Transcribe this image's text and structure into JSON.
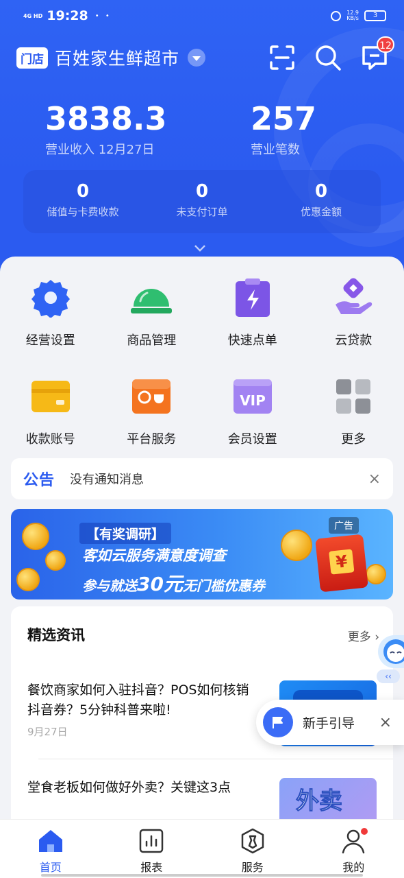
{
  "status_bar": {
    "network": "4G HD",
    "time": "19:28",
    "dots": "• •",
    "speed_value": "12.9",
    "speed_unit": "KB/s",
    "battery": "3"
  },
  "store": {
    "tag": "门店",
    "name": "百姓家生鲜超市",
    "message_badge": "12"
  },
  "kpis": {
    "revenue_value": "3838.3",
    "revenue_label": "营业收入 12月27日",
    "count_value": "257",
    "count_label": "营业笔数"
  },
  "sub_stats": [
    {
      "value": "0",
      "label": "储值与卡费收款"
    },
    {
      "value": "0",
      "label": "未支付订单"
    },
    {
      "value": "0",
      "label": "优惠金额"
    }
  ],
  "grid": [
    {
      "label": "经营设置",
      "icon": "gear-icon"
    },
    {
      "label": "商品管理",
      "icon": "service-bell-icon"
    },
    {
      "label": "快速点单",
      "icon": "lightning-clipboard-icon"
    },
    {
      "label": "云贷款",
      "icon": "loan-hand-icon"
    },
    {
      "label": "收款账号",
      "icon": "card-icon"
    },
    {
      "label": "平台服务",
      "icon": "platform-icon"
    },
    {
      "label": "会员设置",
      "icon": "vip-icon"
    },
    {
      "label": "更多",
      "icon": "more-grid-icon"
    }
  ],
  "notice": {
    "tag_a": "公",
    "tag_b": "告",
    "message": "没有通知消息",
    "close": "×"
  },
  "banner": {
    "line1": "【有奖调研】",
    "line2": "客如云服务满意度调查",
    "line3_a": "参与就送",
    "line3_b": "30元",
    "line3_c": "无门槛优惠券",
    "ad": "广告",
    "yen": "¥"
  },
  "news": {
    "heading": "精选资讯",
    "more": "更多 ›",
    "articles": [
      {
        "title": "餐饮商家如何入驻抖音？POS如何核销抖音券？5分钟科普来啦!",
        "date": "9月27日"
      },
      {
        "title": "堂食老板如何做好外卖？关键这3点",
        "date": "",
        "thumb_text": "外卖"
      }
    ]
  },
  "guide": {
    "label": "新手引导",
    "close": "×"
  },
  "mascot_tab": "‹‹",
  "tabs": [
    {
      "label": "首页",
      "icon": "home-icon",
      "active": true
    },
    {
      "label": "报表",
      "icon": "chart-icon"
    },
    {
      "label": "服务",
      "icon": "service-icon"
    },
    {
      "label": "我的",
      "icon": "profile-icon"
    }
  ],
  "colors": {
    "brand_blue": "#2b5bf0",
    "badge_red": "#f04040",
    "notice_green": "#1a9f6a"
  }
}
